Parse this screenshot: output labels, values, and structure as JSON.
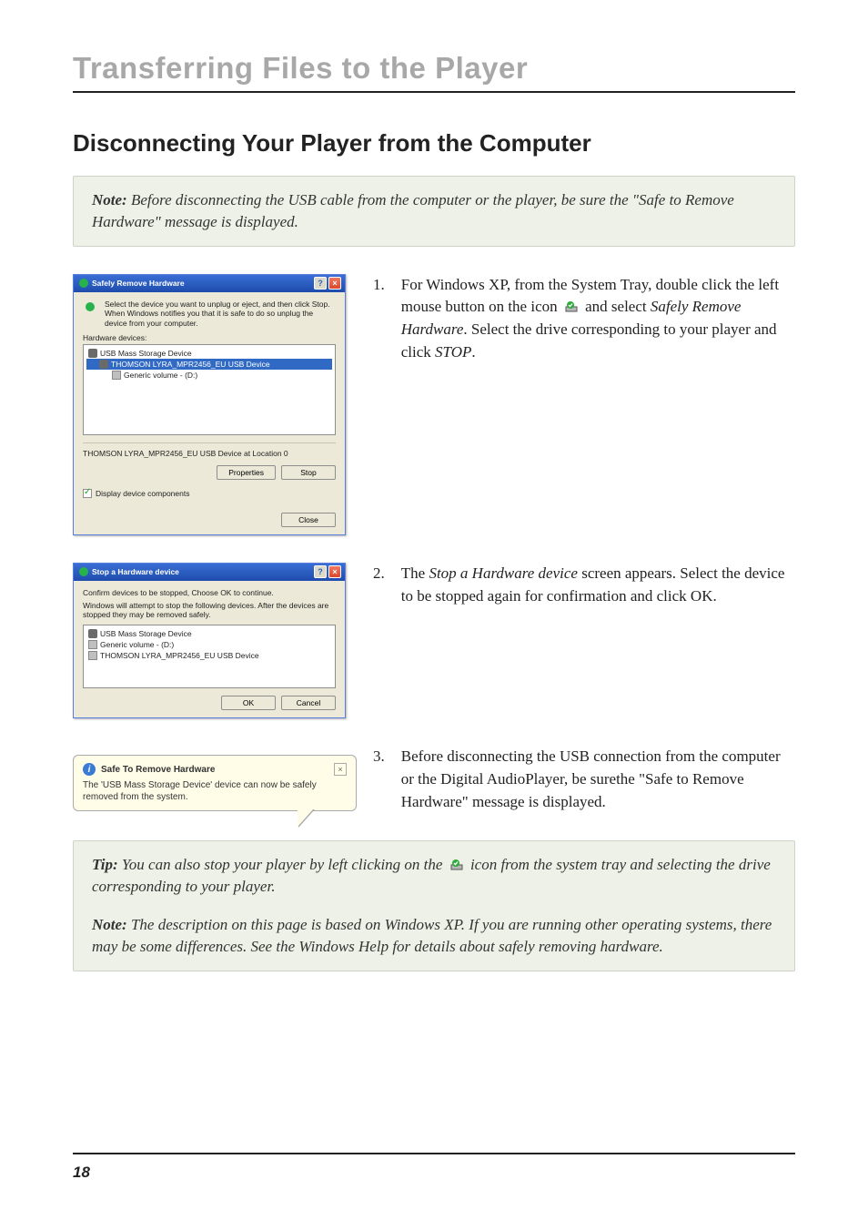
{
  "chapter_title": "Transferring Files to the Player",
  "section_title": "Disconnecting Your Player from the Computer",
  "note1": {
    "label": "Note:",
    "text": " Before disconnecting the USB cable from the computer or the player, be sure the \"Safe to Remove Hardware\" message is displayed."
  },
  "dialog1": {
    "title": "Safely Remove Hardware",
    "instruction": "Select the device you want to unplug or eject, and then click Stop. When Windows notifies you that it is safe to do so unplug the device from your computer.",
    "list_label": "Hardware devices:",
    "items": {
      "root": "USB Mass Storage Device",
      "selected": "THOMSON LYRA_MPR2456_EU USB Device",
      "child": "Generic volume - (D:)"
    },
    "status": "THOMSON LYRA_MPR2456_EU USB Device at Location 0",
    "btn_properties": "Properties",
    "btn_stop": "Stop",
    "chk_label": "Display device components",
    "btn_close": "Close"
  },
  "step1": {
    "num": "1.",
    "text_a": "For Windows XP, from the System Tray, double click the left mouse button on the icon ",
    "text_b": " and select ",
    "em1": "Safely Remove Hardware",
    "text_c": ". Select the drive corresponding to your player and click ",
    "em2": "STOP",
    "text_d": "."
  },
  "dialog2": {
    "title": "Stop a Hardware device",
    "line1": "Confirm devices to be stopped, Choose OK to continue.",
    "line2": "Windows will attempt to stop the following devices. After the devices are stopped they may be removed safely.",
    "items": {
      "root": "USB Mass Storage Device",
      "vol": "Generic volume - (D:)",
      "dev": "THOMSON LYRA_MPR2456_EU USB Device"
    },
    "btn_ok": "OK",
    "btn_cancel": "Cancel"
  },
  "step2": {
    "num": "2.",
    "text_a": "The ",
    "em1": "Stop a Hardware device",
    "text_b": " screen appears. Select the device to be stopped again for confirmation and click OK."
  },
  "balloon": {
    "title": "Safe To Remove Hardware",
    "text": "The 'USB Mass Storage Device' device can now be safely removed from the system."
  },
  "step3": {
    "num": "3.",
    "text": "Before disconnecting the USB connection from the computer or the Digital AudioPlayer, be surethe \"Safe to Remove Hardware\" message is displayed."
  },
  "tip": {
    "label": "Tip:",
    "text_a": " You can also stop your player by left clicking on the ",
    "text_b": " icon from the system tray and selecting the drive corresponding to your player."
  },
  "note2": {
    "label": "Note:",
    "text": " The description on this page is based on Windows XP. If you are running other operating systems, there may be some differences. See the Windows Help for details about safely removing hardware."
  },
  "page_number": "18"
}
